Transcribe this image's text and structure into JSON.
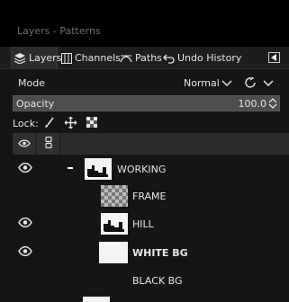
{
  "window": {
    "title": "Layers - Patterns"
  },
  "tabs": [
    {
      "label": "Layers",
      "icon": "layers-icon",
      "active": true
    },
    {
      "label": "Channels",
      "icon": "channels-icon",
      "active": false
    },
    {
      "label": "Paths",
      "icon": "paths-icon",
      "active": false
    },
    {
      "label": "Undo History",
      "icon": "undo-icon",
      "active": false
    }
  ],
  "mode": {
    "label": "Mode",
    "value": "Normal"
  },
  "opacity": {
    "label": "Opacity",
    "value": "100.0",
    "fraction": 1.0
  },
  "lock": {
    "label": "Lock:"
  },
  "layers": [
    {
      "name": "WORKING",
      "group": true,
      "expanded": true,
      "visible": true,
      "bold": false,
      "thumb": "hill"
    },
    {
      "name": "FRAME",
      "visible": false,
      "bold": false,
      "thumb": "checker"
    },
    {
      "name": "HILL",
      "visible": true,
      "bold": false,
      "thumb": "hill"
    },
    {
      "name": "WHITE BG",
      "visible": true,
      "bold": true,
      "thumb": "white"
    },
    {
      "name": "BLACK BG",
      "visible": false,
      "bold": false,
      "thumb": "none"
    }
  ]
}
